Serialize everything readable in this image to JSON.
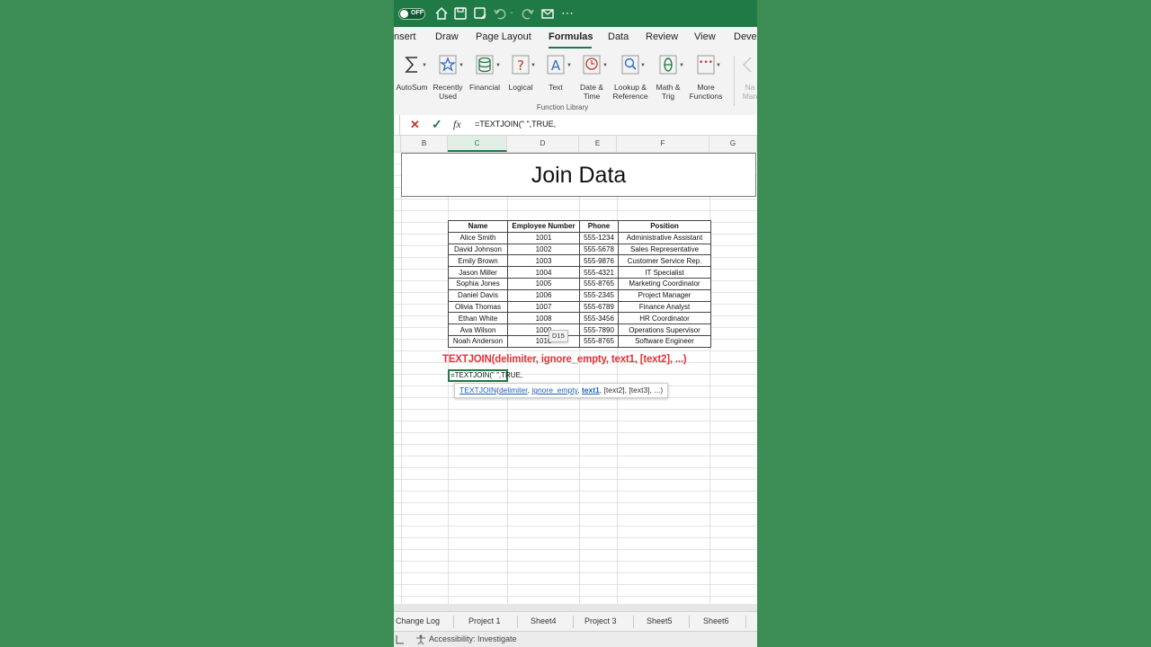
{
  "topbar": {
    "toggle_label": "OFF"
  },
  "tabs": [
    "nsert",
    "Draw",
    "Page Layout",
    "Formulas",
    "Data",
    "Review",
    "View",
    "Deve"
  ],
  "ribbon": {
    "buttons": [
      {
        "label": "AutoSum",
        "icon": "sigma-icon"
      },
      {
        "label": "Recently\nUsed",
        "icon": "star-icon"
      },
      {
        "label": "Financial",
        "icon": "coins-icon"
      },
      {
        "label": "Logical",
        "icon": "question-icon"
      },
      {
        "label": "Text",
        "icon": "text-a-icon"
      },
      {
        "label": "Date &\nTime",
        "icon": "clock-icon"
      },
      {
        "label": "Lookup &\nReference",
        "icon": "magnifier-icon"
      },
      {
        "label": "Math &\nTrig",
        "icon": "theta-icon"
      },
      {
        "label": "More\nFunctions",
        "icon": "dots-icon"
      },
      {
        "label": "Na\nMan",
        "icon": "tag-icon"
      }
    ],
    "group_label": "Function Library"
  },
  "formula_bar": {
    "fx": "fx",
    "text": "=TEXTJOIN(\" \",TRUE,"
  },
  "columns": [
    "B",
    "C",
    "D",
    "E",
    "F",
    "G"
  ],
  "title": "Join Data",
  "table": {
    "headers": [
      "Name",
      "Employee Number",
      "Phone",
      "Position"
    ],
    "rows": [
      [
        "Alice Smith",
        "1001",
        "555-1234",
        "Administrative Assistant"
      ],
      [
        "David Johnson",
        "1002",
        "555-5678",
        "Sales Representative"
      ],
      [
        "Emily Brown",
        "1003",
        "555-9876",
        "Customer Service Rep."
      ],
      [
        "Jason Miller",
        "1004",
        "555-4321",
        "IT Specialist"
      ],
      [
        "Sophia Jones",
        "1005",
        "555-8765",
        "Marketing Coordinator"
      ],
      [
        "Daniel Davis",
        "1006",
        "555-2345",
        "Project Manager"
      ],
      [
        "Olivia Thomas",
        "1007",
        "555-6789",
        "Finance Analyst"
      ],
      [
        "Ethan White",
        "1008",
        "555-3456",
        "HR Coordinator"
      ],
      [
        "Ava Wilson",
        "1009",
        "555-7890",
        "Operations Supervisor"
      ],
      [
        "Noah Anderson",
        "1010",
        "555-8765",
        "Software Engineer"
      ]
    ]
  },
  "cell_tip": "D15",
  "syntax_note": "TEXTJOIN(delimiter, ignore_empty, text1, [text2], ...)",
  "active_cell_text": "=TEXTJOIN(\" \",TRUE,",
  "tooltip": {
    "fn": "TEXTJOIN",
    "open": "(",
    "arg1": "delimiter",
    "sep": ", ",
    "arg2": "ignore_empty",
    "arg3": "text1",
    "rest": ", [text2], [text3], ...)"
  },
  "sheets": [
    "Change Log",
    "Project 1",
    "Sheet4",
    "Project 3",
    "Sheet5",
    "Sheet6"
  ],
  "status": {
    "accessibility": "Accessibility: Investigate"
  },
  "colors": {
    "excel_green": "#1f7a45",
    "background": "#3c8c55",
    "syntax_red": "#e8303a"
  }
}
